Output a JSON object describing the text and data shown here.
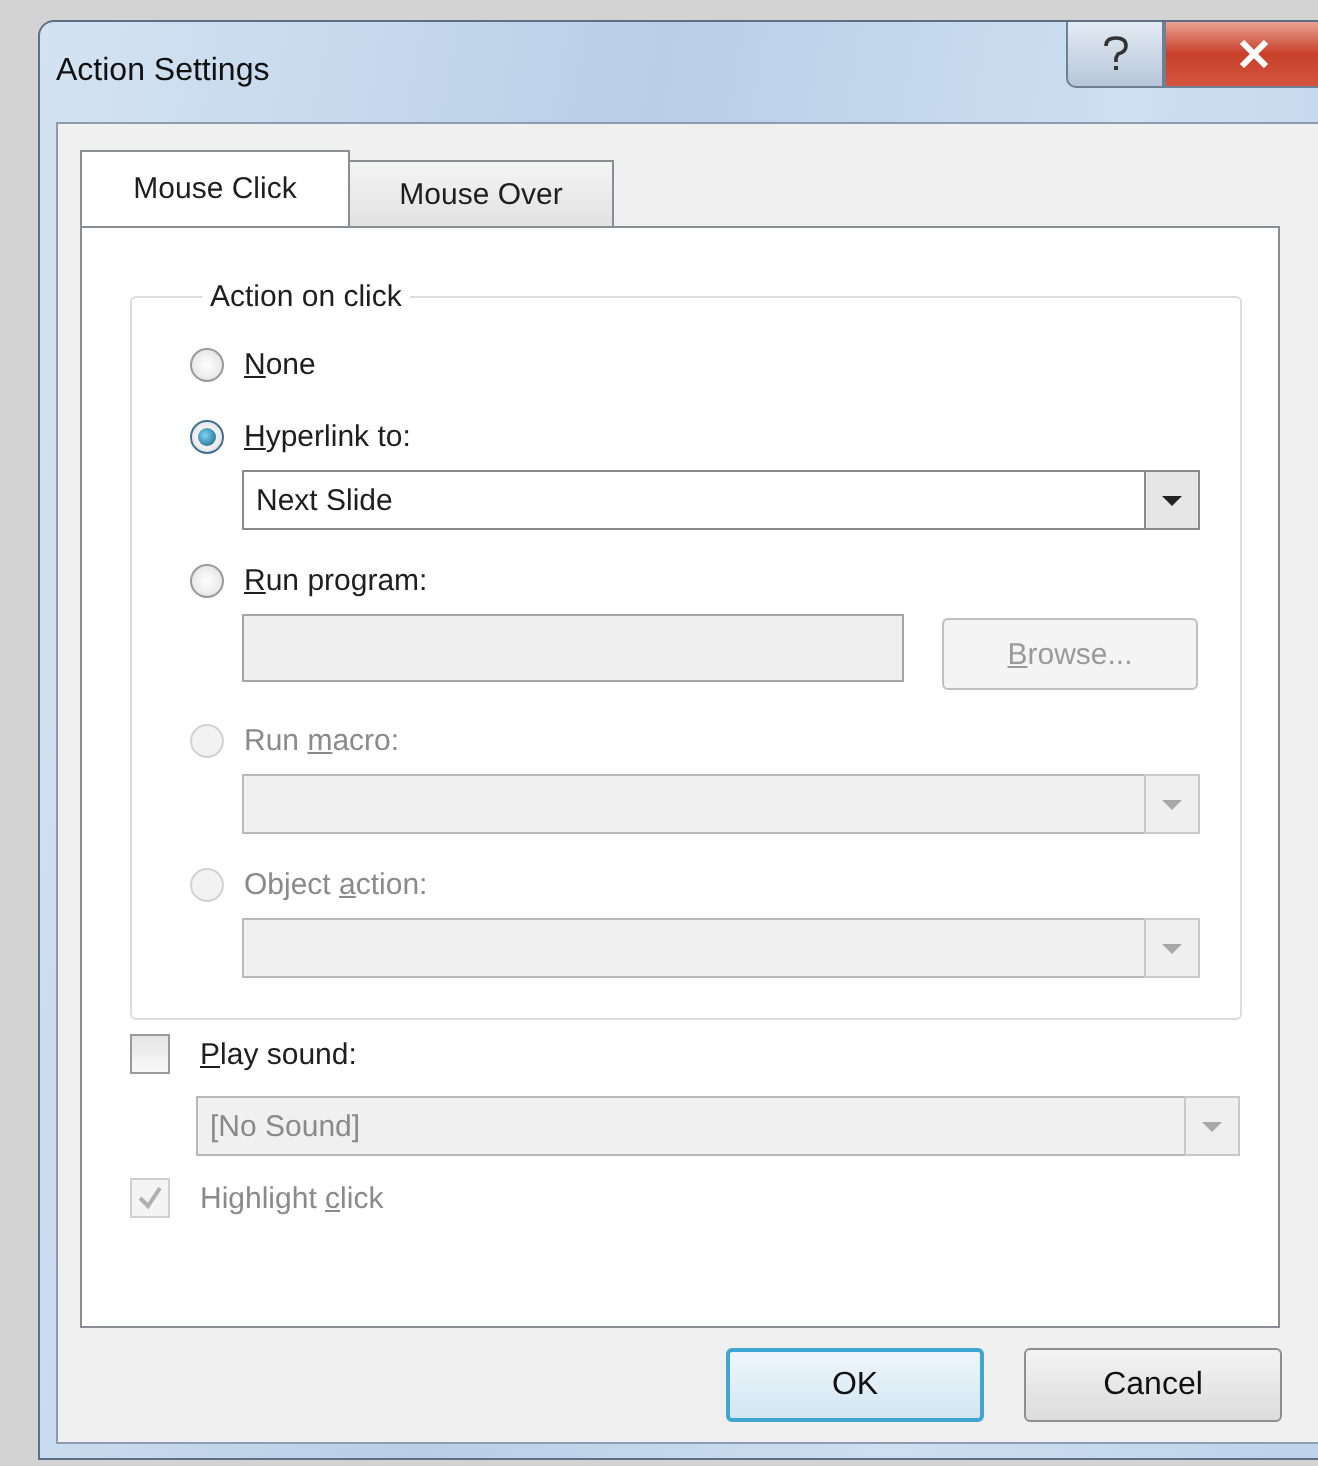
{
  "window": {
    "title": "Action Settings"
  },
  "tabs": [
    {
      "label": "Mouse Click",
      "selected": true
    },
    {
      "label": "Mouse Over",
      "selected": false
    }
  ],
  "group": {
    "legend": "Action on click",
    "items": [
      {
        "kind": "radio",
        "access_key": "N",
        "text_after": "one",
        "selected": false,
        "disabled": false
      },
      {
        "kind": "radio",
        "access_key": "H",
        "text_after": "yperlink to:",
        "selected": true,
        "disabled": false
      },
      {
        "kind": "dropdown",
        "value": "Next Slide",
        "disabled": false
      },
      {
        "kind": "radio",
        "access_key": "R",
        "text_after": "un program:",
        "selected": false,
        "disabled": false
      },
      {
        "kind": "file",
        "button": {
          "access_key": "B",
          "text_after": "rowse..."
        },
        "disabled": true
      },
      {
        "kind": "radio",
        "text_before": "Run ",
        "access_key": "m",
        "text_after": "acro:",
        "selected": false,
        "disabled": true
      },
      {
        "kind": "dropdown",
        "disabled": true
      },
      {
        "kind": "radio",
        "text_before": "Object ",
        "access_key": "a",
        "text_after": "ction:",
        "selected": false,
        "disabled": true
      },
      {
        "kind": "dropdown",
        "disabled": true
      }
    ]
  },
  "play_sound": {
    "access_key": "P",
    "text_after": "lay sound:",
    "checked": false,
    "disabled": false
  },
  "sound": {
    "value": "[No Sound]",
    "disabled": true
  },
  "highlight_click": {
    "text_before": "Highlight ",
    "access_key": "c",
    "text_after": "lick",
    "checked": true,
    "disabled": true
  },
  "buttons": [
    {
      "label": "OK",
      "default": true
    },
    {
      "label": "Cancel",
      "default": false
    }
  ]
}
